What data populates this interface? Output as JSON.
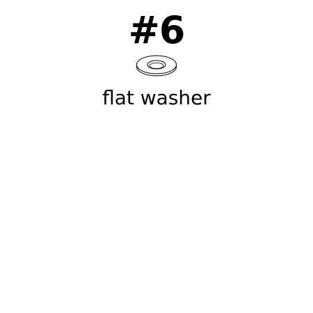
{
  "label": {
    "size": "#6",
    "name": "flat washer"
  },
  "icon": "flat-washer-icon"
}
